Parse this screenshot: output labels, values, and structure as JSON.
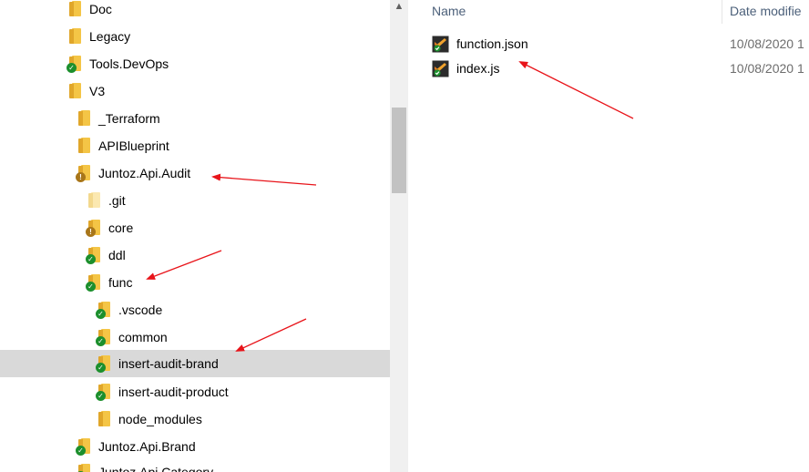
{
  "nav": {
    "items": [
      {
        "label": "Doc",
        "status": "none"
      },
      {
        "label": "Legacy",
        "status": "none"
      },
      {
        "label": "Tools.DevOps",
        "status": "ok"
      },
      {
        "label": "V3",
        "status": "none"
      },
      {
        "label": "_Terraform",
        "status": "none"
      },
      {
        "label": "APIBlueprint",
        "status": "none"
      },
      {
        "label": "Juntoz.Api.Audit",
        "status": "warn"
      },
      {
        "label": ".git",
        "status": "none"
      },
      {
        "label": "core",
        "status": "warn"
      },
      {
        "label": "ddl",
        "status": "ok"
      },
      {
        "label": "func",
        "status": "ok"
      },
      {
        "label": ".vscode",
        "status": "ok"
      },
      {
        "label": "common",
        "status": "ok"
      },
      {
        "label": "insert-audit-brand",
        "status": "ok"
      },
      {
        "label": "insert-audit-product",
        "status": "ok"
      },
      {
        "label": "node_modules",
        "status": "none"
      },
      {
        "label": "Juntoz.Api.Brand",
        "status": "ok"
      },
      {
        "label": "Juntoz.Api.Category",
        "status": "ok"
      }
    ]
  },
  "file_list": {
    "columns": {
      "name": "Name",
      "date": "Date modifie"
    },
    "files": [
      {
        "name": "function.json",
        "date": "10/08/2020 1",
        "icon": "vscode-file-icon"
      },
      {
        "name": "index.js",
        "date": "10/08/2020 1",
        "icon": "vscode-file-icon"
      }
    ]
  },
  "colors": {
    "selection": "#d9d9d9",
    "folder": "#f4c546",
    "status_ok": "#1c8f2d",
    "status_warn": "#a8761a",
    "arrow": "#e8141a"
  }
}
